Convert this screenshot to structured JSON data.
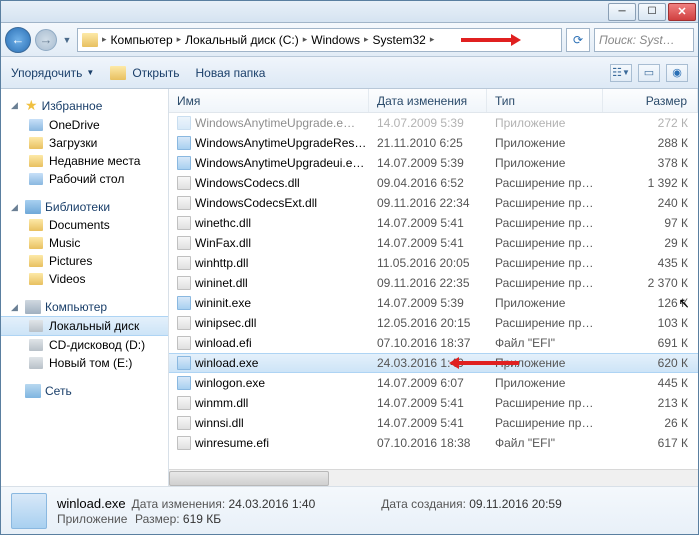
{
  "breadcrumb": [
    "Компьютер",
    "Локальный диск (C:)",
    "Windows",
    "System32"
  ],
  "search_placeholder": "Поиск: Syst…",
  "toolbar": {
    "organize": "Упорядочить",
    "open": "Открыть",
    "new_folder": "Новая папка"
  },
  "sidebar": {
    "favorites": "Избранное",
    "fav_items": [
      "OneDrive",
      "Загрузки",
      "Недавние места",
      "Рабочий стол"
    ],
    "libraries": "Библиотеки",
    "lib_items": [
      "Documents",
      "Music",
      "Pictures",
      "Videos"
    ],
    "computer": "Компьютер",
    "comp_items": [
      "Локальный диск",
      "CD-дисковод (D:)",
      "Новый том (E:)"
    ],
    "network": "Сеть"
  },
  "columns": {
    "name": "Имя",
    "date": "Дата изменения",
    "type": "Тип",
    "size": "Размер"
  },
  "files": [
    {
      "name": "WindowsAnytimeUpgrade.e…",
      "date": "14.07.2009 5:39",
      "type": "Приложение",
      "size": "272 К",
      "ic": "exe",
      "cut": true
    },
    {
      "name": "WindowsAnytimeUpgradeRes…",
      "date": "21.11.2010 6:25",
      "type": "Приложение",
      "size": "288 К",
      "ic": "exe"
    },
    {
      "name": "WindowsAnytimeUpgradeui.e…",
      "date": "14.07.2009 5:39",
      "type": "Приложение",
      "size": "378 К",
      "ic": "exe"
    },
    {
      "name": "WindowsCodecs.dll",
      "date": "09.04.2016 6:52",
      "type": "Расширение при…",
      "size": "1 392 К",
      "ic": "dll"
    },
    {
      "name": "WindowsCodecsExt.dll",
      "date": "09.11.2016 22:34",
      "type": "Расширение при…",
      "size": "240 К",
      "ic": "dll"
    },
    {
      "name": "winethc.dll",
      "date": "14.07.2009 5:41",
      "type": "Расширение при…",
      "size": "97 К",
      "ic": "dll"
    },
    {
      "name": "WinFax.dll",
      "date": "14.07.2009 5:41",
      "type": "Расширение при…",
      "size": "29 К",
      "ic": "dll"
    },
    {
      "name": "winhttp.dll",
      "date": "11.05.2016 20:05",
      "type": "Расширение при…",
      "size": "435 К",
      "ic": "dll"
    },
    {
      "name": "wininet.dll",
      "date": "09.11.2016 22:35",
      "type": "Расширение при…",
      "size": "2 370 К",
      "ic": "dll"
    },
    {
      "name": "wininit.exe",
      "date": "14.07.2009 5:39",
      "type": "Приложение",
      "size": "126 К",
      "ic": "exe",
      "cursor": true
    },
    {
      "name": "winipsec.dll",
      "date": "12.05.2016 20:15",
      "type": "Расширение при…",
      "size": "103 К",
      "ic": "dll"
    },
    {
      "name": "winload.efi",
      "date": "07.10.2016 18:37",
      "type": "Файл \"EFI\"",
      "size": "691 К",
      "ic": "dll"
    },
    {
      "name": "winload.exe",
      "date": "24.03.2016 1:40",
      "type": "Приложение",
      "size": "620 К",
      "ic": "exe",
      "sel": true,
      "arrow": true
    },
    {
      "name": "winlogon.exe",
      "date": "14.07.2009 6:07",
      "type": "Приложение",
      "size": "445 К",
      "ic": "exe"
    },
    {
      "name": "winmm.dll",
      "date": "14.07.2009 5:41",
      "type": "Расширение при…",
      "size": "213 К",
      "ic": "dll"
    },
    {
      "name": "winnsi.dll",
      "date": "14.07.2009 5:41",
      "type": "Расширение при…",
      "size": "26 К",
      "ic": "dll"
    },
    {
      "name": "winresume.efi",
      "date": "07.10.2016 18:38",
      "type": "Файл \"EFI\"",
      "size": "617 К",
      "ic": "dll"
    }
  ],
  "details": {
    "filename": "winload.exe",
    "type": "Приложение",
    "mod_label": "Дата изменения:",
    "mod_value": "24.03.2016 1:40",
    "created_label": "Дата создания:",
    "created_value": "09.11.2016 20:59",
    "size_label": "Размер:",
    "size_value": "619 КБ"
  }
}
